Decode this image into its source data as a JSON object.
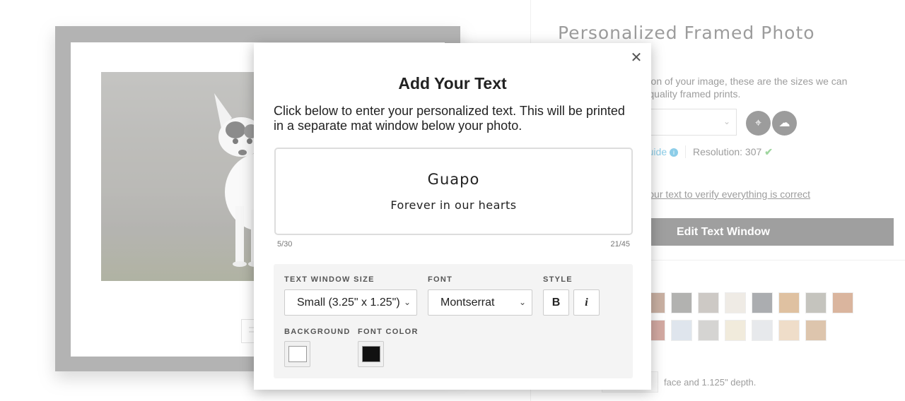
{
  "product": {
    "title": "Personalized Framed Photo",
    "description": "Based on the resolution of your image, these are the sizes we can recommend for high quality framed prints.",
    "size_guide_label": "Size Guide",
    "resolution_label": "Resolution: 307",
    "verify_text": "Please preview your text to verify everything is correct",
    "edit_text_window_button": "Edit Text Window",
    "depth_note": "face and 1.125\" depth.",
    "crop_icon": "crop-icon",
    "upload_icon": "cloud-upload-icon",
    "frame_swatch_colors": [
      "#a2775f",
      "#7b7b78",
      "#a9a39b",
      "#e4ddd2",
      "#6e7377",
      "#c8955e",
      "#9c9a8f",
      "#c08058",
      "#b36c5f",
      "#c9d3e0",
      "#b7b6b1",
      "#e7dcc3",
      "#d6d9de",
      "#e3c5a3",
      "#c49b72"
    ]
  },
  "modal": {
    "title": "Add Your Text",
    "description": "Click below to enter your personalized text. This will be printed in a separate mat window below your photo.",
    "close_icon": "close-icon",
    "preview": {
      "line1": "Guapo",
      "line2": "Forever in our hearts"
    },
    "counter_left": "5/30",
    "counter_right": "21/45",
    "controls": {
      "size_label": "TEXT WINDOW SIZE",
      "size_value": "Small (3.25\" x 1.25\")",
      "font_label": "FONT",
      "font_value": "Montserrat",
      "style_label": "STYLE",
      "bold_label": "B",
      "italic_label": "i",
      "background_label": "BACKGROUND",
      "background_color": "#ffffff",
      "font_color_label": "FONT COLOR",
      "font_color": "#111111"
    }
  }
}
